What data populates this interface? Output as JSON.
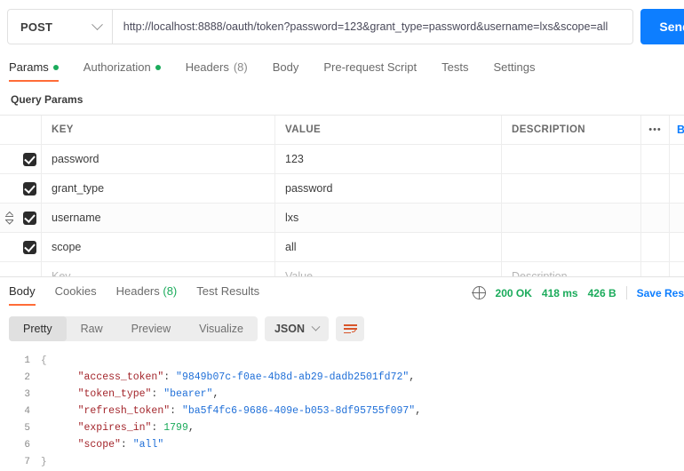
{
  "request": {
    "method": "POST",
    "url": "http://localhost:8888/oauth/token?password=123&grant_type=password&username=lxs&scope=all",
    "send_label": "Send",
    "tabs": [
      {
        "label": "Params",
        "dot": true
      },
      {
        "label": "Authorization",
        "dot": true
      },
      {
        "label": "Headers",
        "count": "(8)"
      },
      {
        "label": "Body"
      },
      {
        "label": "Pre-request Script"
      },
      {
        "label": "Tests"
      },
      {
        "label": "Settings"
      }
    ]
  },
  "params": {
    "section_title": "Query Params",
    "columns": {
      "key": "KEY",
      "value": "VALUE",
      "description": "DESCRIPTION",
      "bulk": "Bulk Edit",
      "menu": "•••"
    },
    "rows": [
      {
        "checked": true,
        "key": "password",
        "value": "123",
        "description": ""
      },
      {
        "checked": true,
        "key": "grant_type",
        "value": "password",
        "description": ""
      },
      {
        "checked": true,
        "key": "username",
        "value": "lxs",
        "description": ""
      },
      {
        "checked": true,
        "key": "scope",
        "value": "all",
        "description": ""
      }
    ],
    "placeholder_row": {
      "key": "Key",
      "value": "Value",
      "description": "Description"
    }
  },
  "response": {
    "tabs": [
      {
        "label": "Body"
      },
      {
        "label": "Cookies"
      },
      {
        "label": "Headers",
        "count": "(8)"
      },
      {
        "label": "Test Results"
      }
    ],
    "status": "200 OK",
    "time": "418 ms",
    "size": "426 B",
    "save_label": "Save Res",
    "formats": [
      "Pretty",
      "Raw",
      "Preview",
      "Visualize"
    ],
    "active_format": "Pretty",
    "language": "JSON",
    "body": {
      "access_token": "9849b07c-f0ae-4b8d-ab29-dadb2501fd72",
      "token_type": "bearer",
      "refresh_token": "ba5f4fc6-9686-409e-b053-8df95755f097",
      "expires_in": 1799,
      "scope": "all"
    },
    "code_lines": [
      {
        "no": "1",
        "fold": "{",
        "segments": []
      },
      {
        "no": "2",
        "fold": "",
        "segments": [
          {
            "t": "    \"access_token\"",
            "c": "k"
          },
          {
            "t": ": ",
            "c": "p"
          },
          {
            "t": "\"9849b07c-f0ae-4b8d-ab29-dadb2501fd72\"",
            "c": "s"
          },
          {
            "t": ",",
            "c": "p"
          }
        ]
      },
      {
        "no": "3",
        "fold": "",
        "segments": [
          {
            "t": "    \"token_type\"",
            "c": "k"
          },
          {
            "t": ": ",
            "c": "p"
          },
          {
            "t": "\"bearer\"",
            "c": "s"
          },
          {
            "t": ",",
            "c": "p"
          }
        ]
      },
      {
        "no": "4",
        "fold": "",
        "segments": [
          {
            "t": "    \"refresh_token\"",
            "c": "k"
          },
          {
            "t": ": ",
            "c": "p"
          },
          {
            "t": "\"ba5f4fc6-9686-409e-b053-8df95755f097\"",
            "c": "s"
          },
          {
            "t": ",",
            "c": "p"
          }
        ]
      },
      {
        "no": "5",
        "fold": "",
        "segments": [
          {
            "t": "    \"expires_in\"",
            "c": "k"
          },
          {
            "t": ": ",
            "c": "p"
          },
          {
            "t": "1799",
            "c": "n"
          },
          {
            "t": ",",
            "c": "p"
          }
        ]
      },
      {
        "no": "6",
        "fold": "",
        "segments": [
          {
            "t": "    \"scope\"",
            "c": "k"
          },
          {
            "t": ": ",
            "c": "p"
          },
          {
            "t": "\"all\"",
            "c": "s"
          }
        ]
      },
      {
        "no": "7",
        "fold": "}",
        "segments": []
      }
    ]
  },
  "colors": {
    "accent": "#ff6c37",
    "primary": "#0d7eff",
    "success": "#1bab5b",
    "string": "#1f6fd8",
    "key": "#a3252b"
  }
}
